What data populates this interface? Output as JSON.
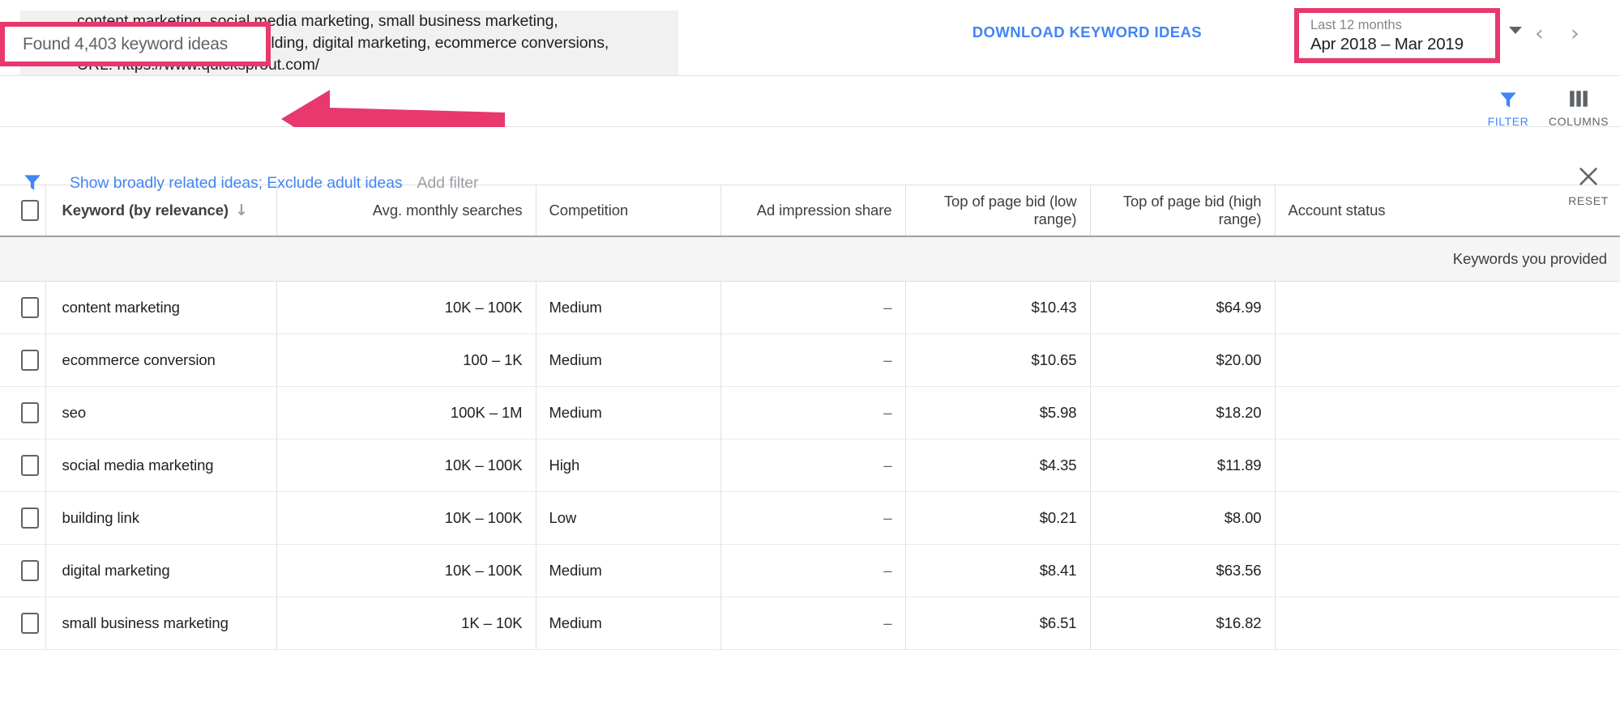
{
  "search": {
    "icon": "search-icon",
    "terms": "content marketing, social media marketing, small business marketing,\nwebsite traffic, SEO, link building, digital marketing, ecommerce conversions,\nURL: https://www.quicksprout.com/"
  },
  "toolbar": {
    "download_label": "DOWNLOAD KEYWORD IDEAS",
    "date_label": "Last 12 months",
    "date_value": "Apr 2018 – Mar 2019",
    "prev_icon": "chevron-left-icon",
    "next_icon": "chevron-right-icon",
    "caret_icon": "chevron-down-icon"
  },
  "results": {
    "found_text": "Found 4,403 keyword ideas",
    "filter_caption": "FILTER",
    "columns_caption": "COLUMNS",
    "filter_icon": "funnel-icon",
    "columns_icon": "columns-icon"
  },
  "filters": {
    "active_chip": "Show broadly related ideas; Exclude adult ideas",
    "add_filter": "Add filter",
    "reset_caption": "RESET",
    "reset_icon": "close-icon",
    "funnel_icon": "funnel-icon"
  },
  "table": {
    "columns": [
      "Keyword (by relevance)",
      "Avg. monthly searches",
      "Competition",
      "Ad impression share",
      "Top of page bid (low range)",
      "Top of page bid (high range)",
      "Account status"
    ],
    "sort_icon": "arrow-down-icon",
    "group_label": "Keywords you provided",
    "rows": [
      {
        "keyword": "content marketing",
        "avg": "10K – 100K",
        "competition": "Medium",
        "ad_share": "–",
        "bid_low": "$10.43",
        "bid_high": "$64.99",
        "account_status": ""
      },
      {
        "keyword": "ecommerce conversion",
        "avg": "100 – 1K",
        "competition": "Medium",
        "ad_share": "–",
        "bid_low": "$10.65",
        "bid_high": "$20.00",
        "account_status": ""
      },
      {
        "keyword": "seo",
        "avg": "100K – 1M",
        "competition": "Medium",
        "ad_share": "–",
        "bid_low": "$5.98",
        "bid_high": "$18.20",
        "account_status": ""
      },
      {
        "keyword": "social media marketing",
        "avg": "10K – 100K",
        "competition": "High",
        "ad_share": "–",
        "bid_low": "$4.35",
        "bid_high": "$11.89",
        "account_status": ""
      },
      {
        "keyword": "building link",
        "avg": "10K – 100K",
        "competition": "Low",
        "ad_share": "–",
        "bid_low": "$0.21",
        "bid_high": "$8.00",
        "account_status": ""
      },
      {
        "keyword": "digital marketing",
        "avg": "10K – 100K",
        "competition": "Medium",
        "ad_share": "–",
        "bid_low": "$8.41",
        "bid_high": "$63.56",
        "account_status": ""
      },
      {
        "keyword": "small business marketing",
        "avg": "1K – 10K",
        "competition": "Medium",
        "ad_share": "–",
        "bid_low": "$6.51",
        "bid_high": "$16.82",
        "account_status": ""
      }
    ]
  },
  "annotations": {
    "highlight_color": "#e8386d",
    "arrow_name": "pink-arrow-annotation"
  },
  "colors": {
    "accent_blue": "#4285f4",
    "text_primary": "#202124",
    "text_secondary": "#5f6368"
  }
}
